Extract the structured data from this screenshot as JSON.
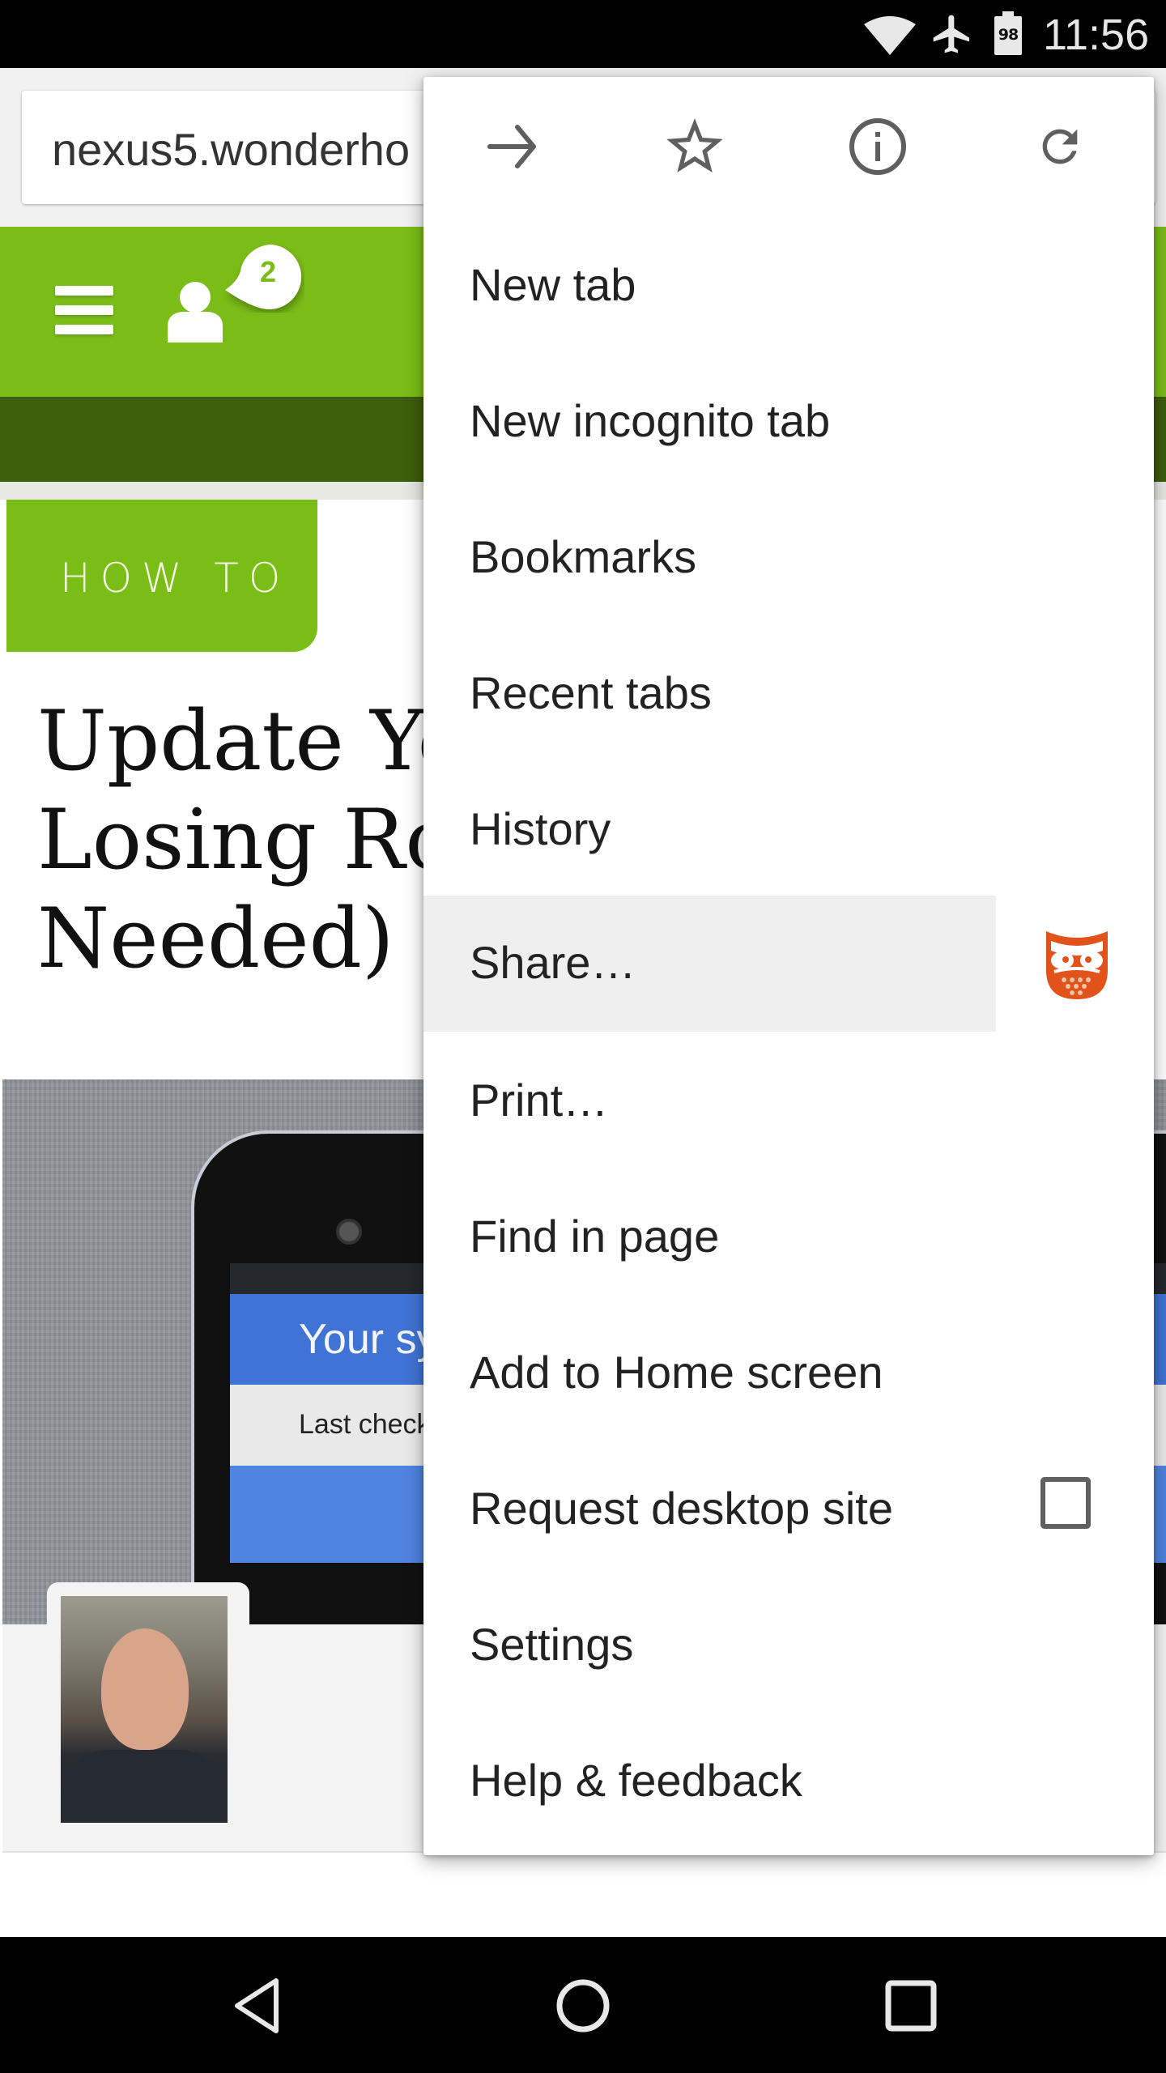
{
  "status_bar": {
    "time": "11:56",
    "battery_level": "98",
    "icons": [
      "wifi-icon",
      "airplane-mode-icon",
      "battery-icon"
    ]
  },
  "browser": {
    "url": "nexus5.wonderho"
  },
  "site_header": {
    "menu_icon": "hamburger-menu-icon",
    "user_icon": "user-icon",
    "notification_count": "2"
  },
  "article": {
    "category_badge": "HOW TO",
    "title_visible": "Update Yo\nLosing Roo\nNeeded)",
    "hero_image": {
      "screen_headline": "Your sy",
      "screen_subtext": "Last check"
    }
  },
  "overflow_menu": {
    "icon_row": [
      {
        "name": "forward-arrow-icon",
        "label": "Forward"
      },
      {
        "name": "bookmark-star-icon",
        "label": "Bookmark"
      },
      {
        "name": "page-info-icon",
        "label": "Page info"
      },
      {
        "name": "reload-icon",
        "label": "Reload"
      }
    ],
    "items": [
      {
        "label": "New tab"
      },
      {
        "label": "New incognito tab"
      },
      {
        "label": "Bookmarks"
      },
      {
        "label": "Recent tabs"
      },
      {
        "label": "History"
      },
      {
        "label": "Share…",
        "highlighted": true,
        "trailing_icon": "owl-app-icon"
      },
      {
        "label": "Print…"
      },
      {
        "label": "Find in page"
      },
      {
        "label": "Add to Home screen"
      },
      {
        "label": "Request desktop site",
        "checkbox": false
      },
      {
        "label": "Settings"
      },
      {
        "label": "Help & feedback"
      }
    ]
  },
  "nav_bar": {
    "buttons": [
      "back-icon",
      "home-icon",
      "recents-icon"
    ]
  },
  "colors": {
    "brand_green": "#7bbd17",
    "brand_dark_green": "#3d5e0b",
    "owl_orange": "#e2531c",
    "menu_highlight": "#efefef",
    "icon_gray": "#606060"
  }
}
